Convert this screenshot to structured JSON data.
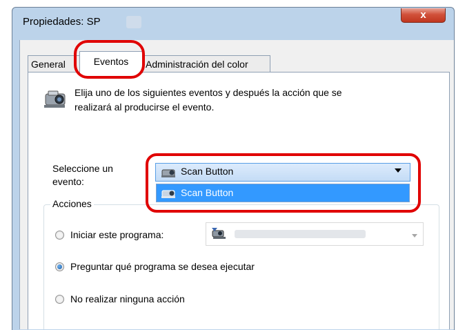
{
  "window": {
    "title": "Propiedades: SP",
    "close_glyph": "x"
  },
  "tabs": [
    {
      "label": "General"
    },
    {
      "label": "Eventos"
    },
    {
      "label": "Administración del color"
    }
  ],
  "description": {
    "line1": "Elija uno de los siguientes eventos y después la acción que se",
    "line2": "realizará al producirse el evento."
  },
  "event_select": {
    "label_line1": "Seleccione un",
    "label_line2": "evento:",
    "selected": "Scan Button",
    "options": [
      "Scan Button"
    ]
  },
  "actions": {
    "legend": "Acciones",
    "start_program": "Iniciar este programa:",
    "ask_program": "Preguntar qué programa se desea ejecutar",
    "no_action": "No realizar ninguna acción",
    "selected_option": "Preguntar qué programa se desea ejecutar"
  },
  "icons": {
    "scanner": "scanner-camera-icon",
    "event": "scanner-small-icon",
    "program": "program-icon",
    "dropdown": "chevron-down-icon"
  },
  "colors": {
    "highlight": "#e00000",
    "selection": "#3399ff"
  }
}
